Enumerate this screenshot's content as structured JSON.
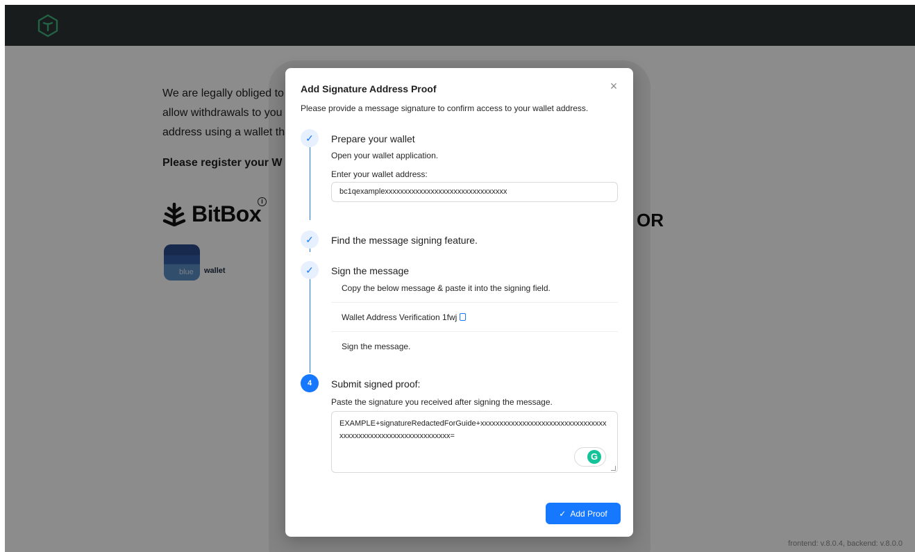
{
  "background": {
    "intro_lines": [
      "We are legally obliged to",
      "allow withdrawals to you",
      "address using a wallet th"
    ],
    "heading": "Please register your W",
    "bitbox_name": "BitBox",
    "bitbox_info": "i",
    "right_partial": "OR",
    "bluewallet_badge": "blue",
    "bluewallet_name": "wallet",
    "version": "frontend: v.8.0.4, backend: v.8.0.0"
  },
  "modal": {
    "title": "Add Signature Address Proof",
    "close_icon": "×",
    "description": "Please provide a message signature to confirm access to your wallet address.",
    "steps": [
      {
        "state": "done",
        "icon": "✓",
        "title": "Prepare your wallet",
        "text": "Open your wallet application.",
        "address_label": "Enter your wallet address:",
        "address_value": "bc1qexamplexxxxxxxxxxxxxxxxxxxxxxxxxxxxxxxx"
      },
      {
        "state": "done",
        "icon": "✓",
        "title": "Find the message signing feature."
      },
      {
        "state": "done",
        "icon": "✓",
        "title": "Sign the message",
        "items": [
          "Copy the below message & paste it into the signing field.",
          "Wallet Address Verification 1fwj",
          "Sign the message."
        ]
      },
      {
        "state": "active",
        "icon": "4",
        "title": "Submit signed proof:",
        "text": "Paste the signature you received after signing the message.",
        "signature_value": "EXAMPLE+signatureRedactedForGuide+xxxxxxxxxxxxxxxxxxxxxxxxxxxxxxxxxxxxxxxxxxxxxxxxxxxxxxxxxxxxxx="
      }
    ],
    "grammarly_label": "G",
    "submit_icon": "✓",
    "submit_label": "Add Proof"
  },
  "colors": {
    "accent": "#1677ff",
    "topbar": "#2e3436",
    "logo": "#3fb37f"
  }
}
